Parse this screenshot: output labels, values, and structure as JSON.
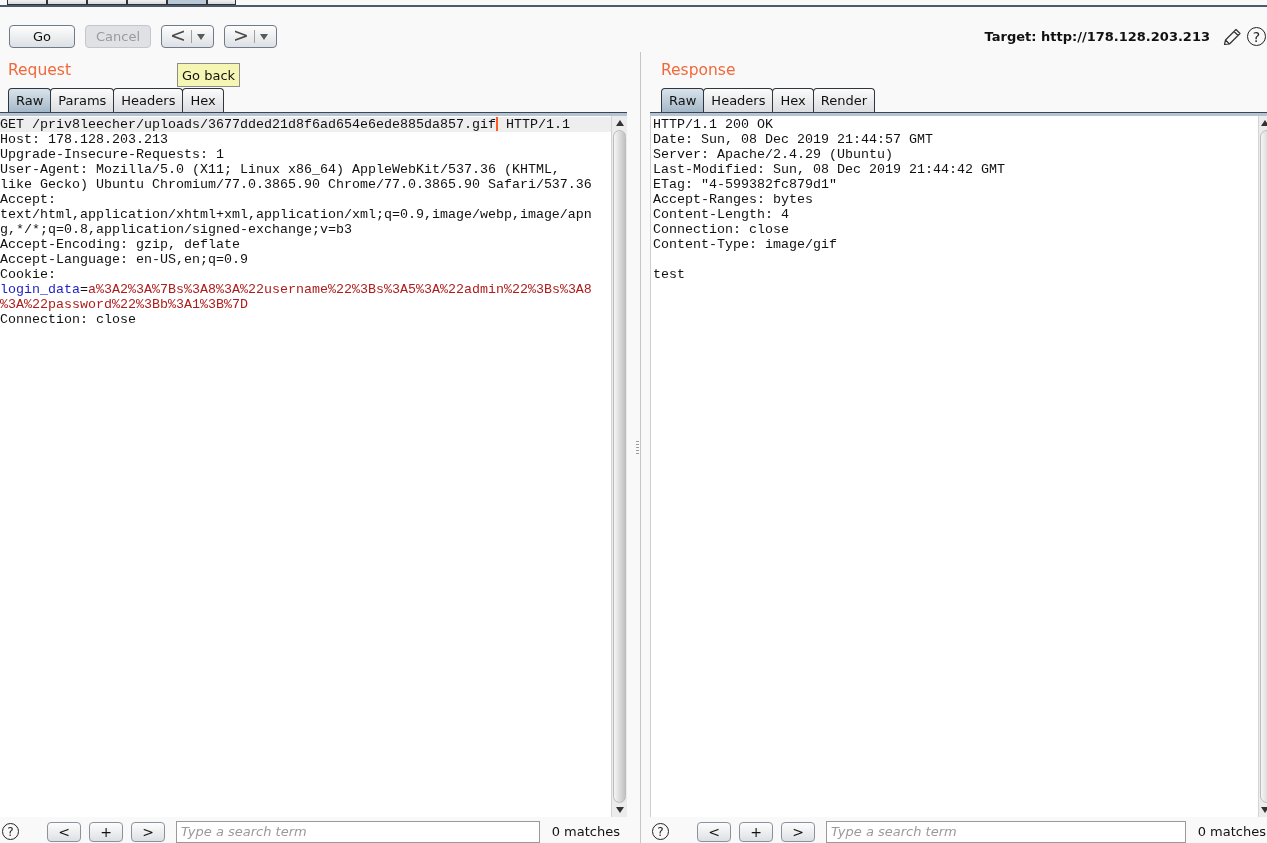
{
  "tool_tabs": [
    {
      "selected": false
    },
    {
      "selected": false
    },
    {
      "selected": false
    },
    {
      "selected": false
    },
    {
      "selected": true
    },
    {
      "selected": false
    }
  ],
  "toolbar": {
    "buttons": [
      {
        "kind": "go",
        "label": "Go",
        "disabled": false
      },
      {
        "kind": "cancel",
        "label": "Cancel",
        "disabled": true
      },
      {
        "kind": "back",
        "label": "<",
        "disabled": false
      },
      {
        "kind": "forward",
        "label": ">",
        "disabled": false
      }
    ],
    "target": "Target: http://178.128.203.213",
    "help": "?"
  },
  "tooltip": {
    "text": "Go back"
  },
  "request": {
    "title": "Request",
    "tabs": [
      {
        "label": "Raw",
        "selected": true
      },
      {
        "label": "Params",
        "selected": false
      },
      {
        "label": "Headers",
        "selected": false
      },
      {
        "label": "Hex",
        "selected": false
      }
    ],
    "lines": [
      {
        "current": true,
        "parts": [
          {
            "kind": "plain",
            "text": "GET /priv8leecher/uploads/3677dded21d8f6ad654e6ede885da857.gif"
          },
          {
            "kind": "caret"
          },
          {
            "kind": "plain",
            "text": " HTTP/1.1"
          }
        ]
      },
      {
        "current": false,
        "text": "Host: 178.128.203.213"
      },
      {
        "current": false,
        "text": "Upgrade-Insecure-Requests: 1"
      },
      {
        "current": false,
        "text": "User-Agent: Mozilla/5.0 (X11; Linux x86_64) AppleWebKit/537.36 (KHTML,"
      },
      {
        "current": false,
        "text": "like Gecko) Ubuntu Chromium/77.0.3865.90 Chrome/77.0.3865.90 Safari/537.36"
      },
      {
        "current": false,
        "text": "Accept:"
      },
      {
        "current": false,
        "text": "text/html,application/xhtml+xml,application/xml;q=0.9,image/webp,image/apn"
      },
      {
        "current": false,
        "text": "g,*/*;q=0.8,application/signed-exchange;v=b3"
      },
      {
        "current": false,
        "text": "Accept-Encoding: gzip, deflate"
      },
      {
        "current": false,
        "text": "Accept-Language: en-US,en;q=0.9"
      },
      {
        "current": false,
        "text": "Cookie:"
      },
      {
        "current": false,
        "parts": [
          {
            "kind": "name",
            "text": "login_data"
          },
          {
            "kind": "plain",
            "text": "="
          },
          {
            "kind": "value",
            "text": "a%3A2%3A%7Bs%3A8%3A%22username%22%3Bs%3A5%3A%22admin%22%3Bs%3A8"
          }
        ]
      },
      {
        "current": false,
        "parts": [
          {
            "kind": "value",
            "text": "%3A%22password%22%3Bb%3A1%3B%7D"
          }
        ]
      },
      {
        "current": false,
        "text": "Connection: close"
      }
    ],
    "search": {
      "help": "?",
      "buttons": [
        "<",
        "+",
        ">"
      ],
      "placeholder": "Type a search term",
      "matches": "0 matches"
    }
  },
  "response": {
    "title": "Response",
    "tabs": [
      {
        "label": "Raw",
        "selected": true
      },
      {
        "label": "Headers",
        "selected": false
      },
      {
        "label": "Hex",
        "selected": false
      },
      {
        "label": "Render",
        "selected": false
      }
    ],
    "headers": [
      "HTTP/1.1 200 OK",
      "Date: Sun, 08 Dec 2019 21:44:57 GMT",
      "Server: Apache/2.4.29 (Ubuntu)",
      "Last-Modified: Sun, 08 Dec 2019 21:44:42 GMT",
      "ETag: \"4-599382fc879d1\"",
      "Accept-Ranges: bytes",
      "Content-Length: 4",
      "Connection: close",
      "Content-Type: image/gif"
    ],
    "body": [
      "test"
    ],
    "search": {
      "help": "?",
      "buttons": [
        "<",
        "+",
        ">"
      ],
      "placeholder": "Type a search term",
      "matches": "0 matches"
    }
  }
}
